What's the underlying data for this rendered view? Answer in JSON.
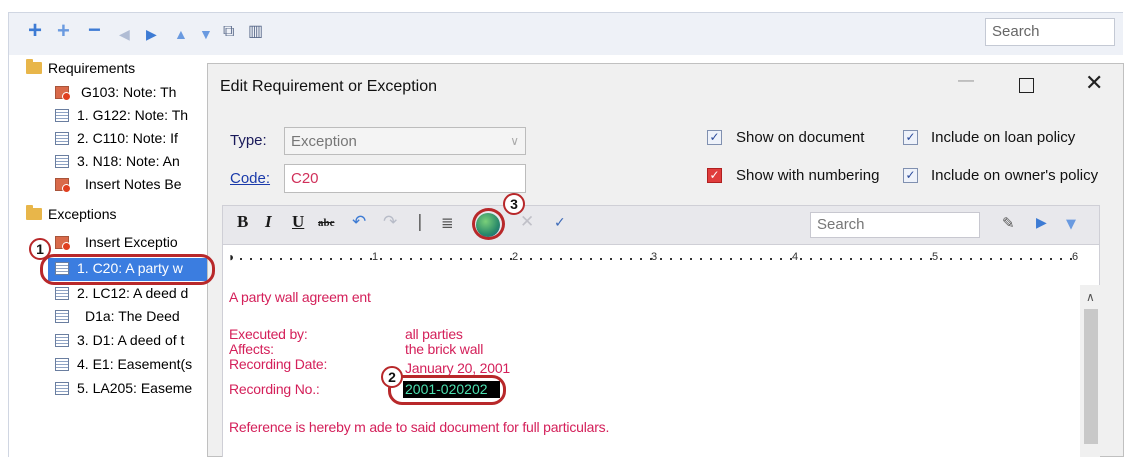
{
  "toolbar": {
    "icons": [
      "add-icon",
      "add-child-icon",
      "remove-icon",
      "move-left-icon",
      "move-right-icon",
      "move-up-icon",
      "move-down-icon",
      "merge-icon",
      "view-icon"
    ],
    "search_placeholder": "Search"
  },
  "tree": {
    "requirements_label": "Requirements",
    "requirements": [
      "G103: Note: Th",
      "1. G122: Note: Th",
      "2. C110: Note: If",
      "3. N18: Note: An",
      "Insert Notes Be"
    ],
    "exceptions_label": "Exceptions",
    "exceptions": [
      "Insert Exceptio",
      "1. C20: A party w",
      "2. LC12: A deed d",
      "D1a: The Deed",
      "3. D1: A deed of t",
      "4. E1: Easement(s",
      "5. LA205: Easeme"
    ]
  },
  "dialog": {
    "title": "Edit Requirement or Exception",
    "type_label": "Type:",
    "type_value": "Exception",
    "code_label": "Code:",
    "code_value": "C20",
    "checkboxes": {
      "show_on_document": "Show on document",
      "show_with_numbering": "Show with numbering",
      "include_loan": "Include on loan policy",
      "include_owner": "Include on owner's policy"
    },
    "editor_search_placeholder": "Search",
    "ruler_numbers": [
      "1",
      "2",
      "3",
      "4",
      "5",
      "6"
    ],
    "body": {
      "line1": "A party wall agreem ent",
      "executed_label": "Executed by:",
      "executed_value": "all parties",
      "affects_label": "Affects:",
      "affects_value": "the brick wall",
      "date_label": "Recording Date:",
      "date_value": "January 20, 2001",
      "no_label": "Recording No.:",
      "no_value": "2001-020202",
      "reference": "Reference is hereby m ade to said document for full particulars."
    }
  },
  "annotations": [
    "1",
    "2",
    "3"
  ],
  "colors": {
    "accent_red": "#b8282a",
    "selection_blue": "#3b7de0",
    "editor_text": "#d4205a"
  }
}
